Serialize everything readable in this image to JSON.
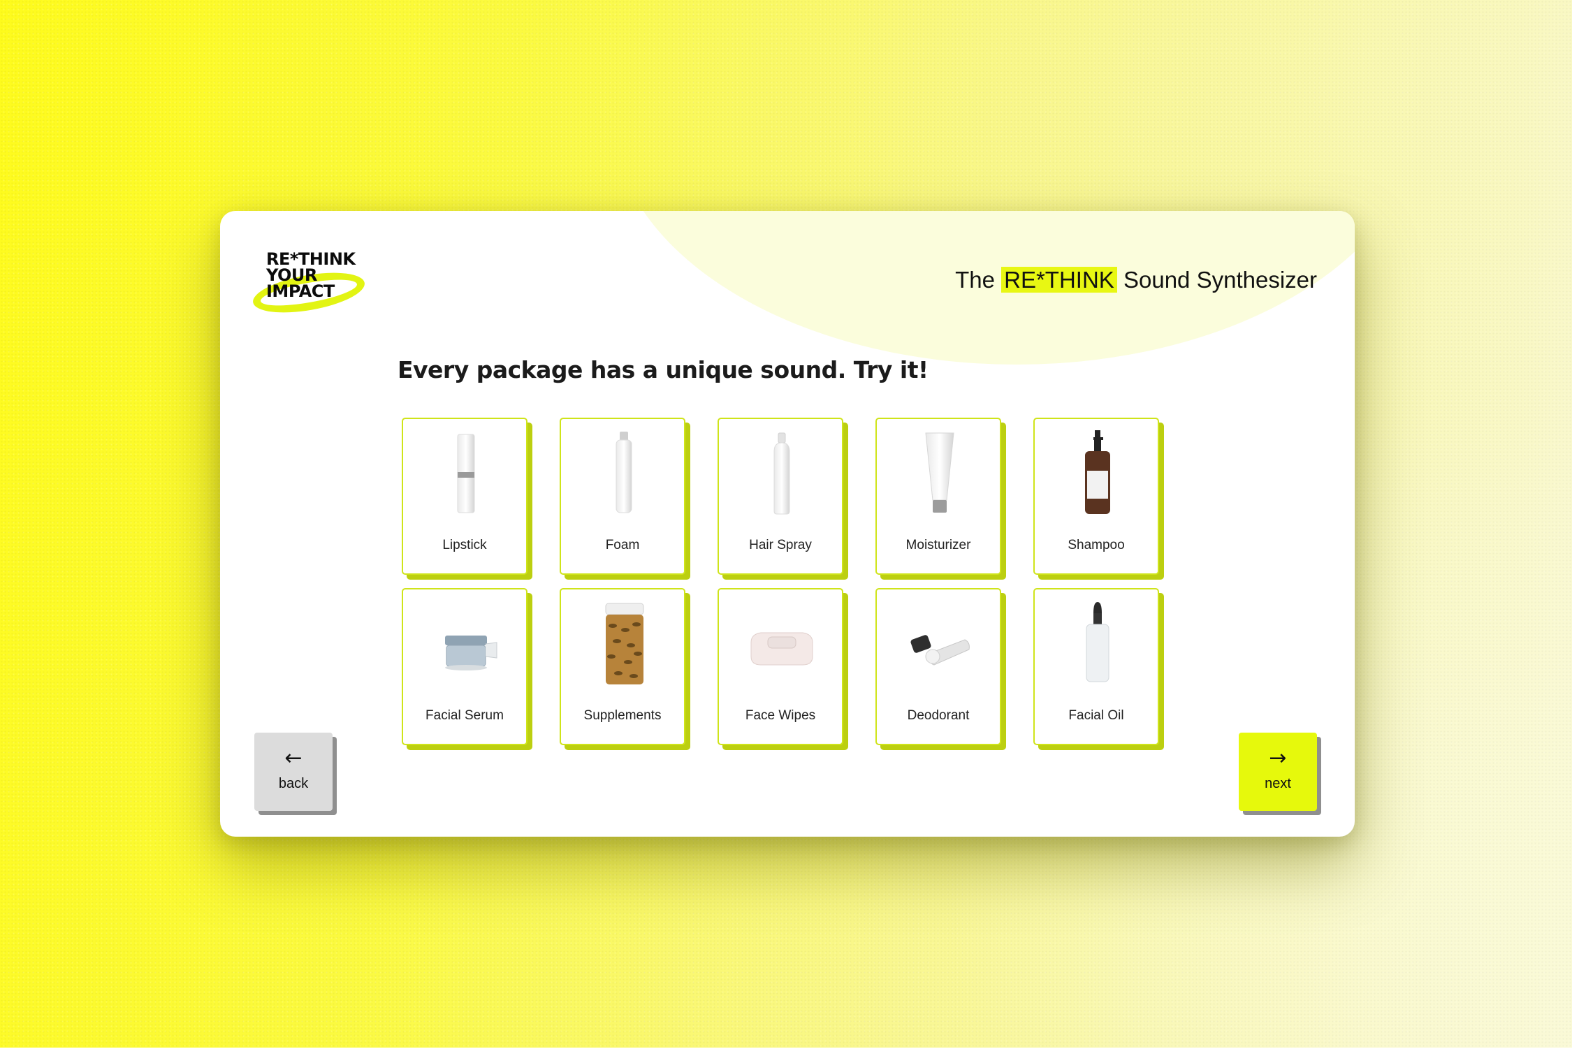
{
  "brand": {
    "logo_lines": [
      "RE*THINK",
      "YOUR",
      "IMPACT"
    ],
    "accent_color": "#e8f713"
  },
  "header": {
    "title_prefix": "The",
    "title_highlight": "RE*THINK",
    "title_suffix": "Sound Synthesizer"
  },
  "main": {
    "heading": "Every package has a unique sound. Try it!",
    "products": [
      {
        "label": "Lipstick",
        "icon": "lipstick-icon"
      },
      {
        "label": "Foam",
        "icon": "foam-can-icon"
      },
      {
        "label": "Hair Spray",
        "icon": "hair-spray-icon"
      },
      {
        "label": "Moisturizer",
        "icon": "moisturizer-tube-icon"
      },
      {
        "label": "Shampoo",
        "icon": "shampoo-bottle-icon"
      },
      {
        "label": "Facial Serum",
        "icon": "serum-jar-icon"
      },
      {
        "label": "Supplements",
        "icon": "supplement-jar-icon"
      },
      {
        "label": "Face Wipes",
        "icon": "wipes-pack-icon"
      },
      {
        "label": "Deodorant",
        "icon": "deodorant-icon"
      },
      {
        "label": "Facial Oil",
        "icon": "dropper-bottle-icon"
      }
    ]
  },
  "nav": {
    "back": {
      "label": "back",
      "arrow": "←"
    },
    "next": {
      "label": "next",
      "arrow": "→"
    }
  }
}
